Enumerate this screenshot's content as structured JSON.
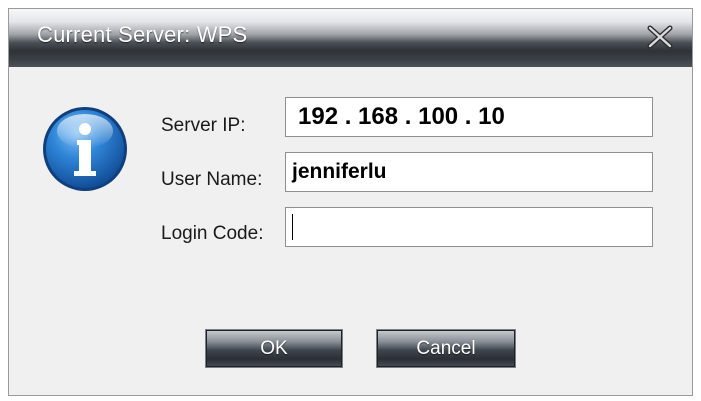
{
  "dialog": {
    "title": "Current Server: WPS"
  },
  "form": {
    "server_ip_label": "Server IP:",
    "server_ip_value": "192 . 168 . 100 . 10",
    "user_name_label": "User Name:",
    "user_name_value": "jenniferlu",
    "login_code_label": "Login Code:",
    "login_code_value": ""
  },
  "buttons": {
    "ok_label": "OK",
    "cancel_label": "Cancel"
  },
  "icons": {
    "close": "close-icon",
    "info": "info-icon"
  },
  "colors": {
    "title_bar_dark": "#2f3338",
    "info_blue": "#1f6fc0"
  }
}
